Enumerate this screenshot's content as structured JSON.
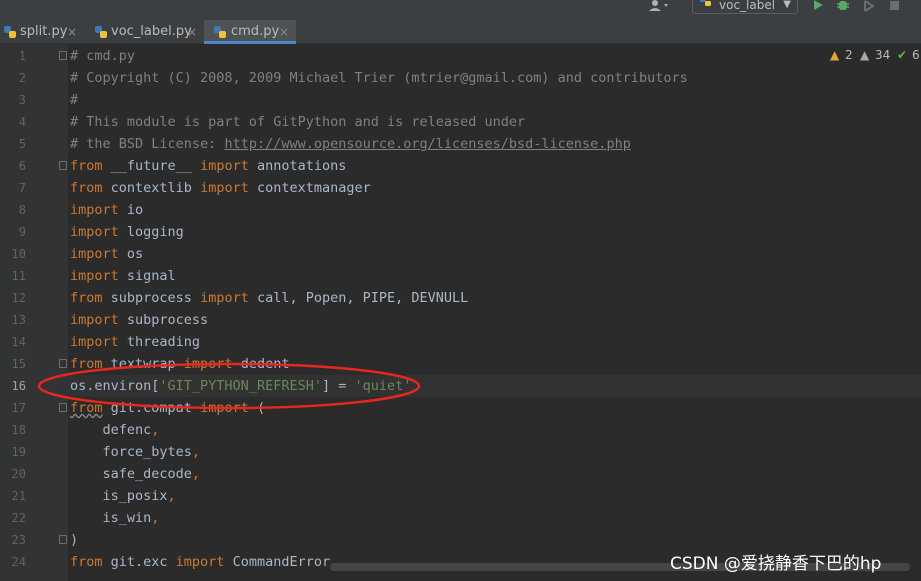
{
  "toolbar": {
    "run_config_label": "voc_label",
    "icons": [
      "user-icon",
      "python-file-icon",
      "chevron-down-icon",
      "run-icon",
      "debug-icon",
      "coverage-icon",
      "stop-icon"
    ]
  },
  "tabs": [
    {
      "label": "split.py",
      "close": "×",
      "active": false
    },
    {
      "label": "voc_label.py",
      "close": "×",
      "active": false
    },
    {
      "label": "cmd.py",
      "close": "×",
      "active": true
    }
  ],
  "inspections": {
    "warnings": "2",
    "weak_warnings": "34",
    "typos": "6",
    "warning_symbol": "▲",
    "weak_symbol": "▲",
    "check_symbol": "✔"
  },
  "current_line": 16,
  "lines": [
    {
      "n": "1",
      "tokens": [
        {
          "t": "cm",
          "v": "# cmd.py"
        }
      ]
    },
    {
      "n": "2",
      "tokens": [
        {
          "t": "cm",
          "v": "# Copyright (C) 2008, 2009 Michael Trier (mtrier@gmail.com) and contributors"
        }
      ]
    },
    {
      "n": "3",
      "tokens": [
        {
          "t": "cm",
          "v": "#"
        }
      ]
    },
    {
      "n": "4",
      "tokens": [
        {
          "t": "cm",
          "v": "# This module is part of GitPython and is released under"
        }
      ]
    },
    {
      "n": "5",
      "tokens": [
        {
          "t": "cm",
          "v": "# the BSD License: "
        },
        {
          "t": "link",
          "v": "http://www.opensource.org/licenses/bsd-license.php"
        }
      ]
    },
    {
      "n": "6",
      "tokens": [
        {
          "t": "kw",
          "v": "from"
        },
        {
          "t": "ident",
          "v": " __future__ "
        },
        {
          "t": "kw",
          "v": "import"
        },
        {
          "t": "ident",
          "v": " annotations"
        }
      ]
    },
    {
      "n": "7",
      "tokens": [
        {
          "t": "kw",
          "v": "from"
        },
        {
          "t": "ident",
          "v": " contextlib "
        },
        {
          "t": "kw",
          "v": "import"
        },
        {
          "t": "ident",
          "v": " contextmanager"
        }
      ]
    },
    {
      "n": "8",
      "tokens": [
        {
          "t": "kw",
          "v": "import"
        },
        {
          "t": "ident",
          "v": " io"
        }
      ]
    },
    {
      "n": "9",
      "tokens": [
        {
          "t": "kw",
          "v": "import"
        },
        {
          "t": "ident",
          "v": " logging"
        }
      ]
    },
    {
      "n": "10",
      "tokens": [
        {
          "t": "kw",
          "v": "import"
        },
        {
          "t": "ident",
          "v": " os"
        }
      ]
    },
    {
      "n": "11",
      "tokens": [
        {
          "t": "kw",
          "v": "import"
        },
        {
          "t": "ident",
          "v": " signal"
        }
      ]
    },
    {
      "n": "12",
      "tokens": [
        {
          "t": "kw",
          "v": "from"
        },
        {
          "t": "ident",
          "v": " subprocess "
        },
        {
          "t": "kw",
          "v": "import"
        },
        {
          "t": "ident",
          "v": " call, Popen, PIPE, DEVNULL"
        }
      ]
    },
    {
      "n": "13",
      "tokens": [
        {
          "t": "kw",
          "v": "import"
        },
        {
          "t": "ident",
          "v": " subprocess"
        }
      ]
    },
    {
      "n": "14",
      "tokens": [
        {
          "t": "kw",
          "v": "import"
        },
        {
          "t": "ident",
          "v": " threading"
        }
      ]
    },
    {
      "n": "15",
      "tokens": [
        {
          "t": "kw",
          "v": "from"
        },
        {
          "t": "ident",
          "v": " textwrap "
        },
        {
          "t": "kw",
          "v": "import"
        },
        {
          "t": "ident",
          "v": " dedent"
        }
      ]
    },
    {
      "n": "16",
      "tokens": [
        {
          "t": "ident",
          "v": "os.environ["
        },
        {
          "t": "st",
          "v": "'GIT_PYTHON_REFRESH'"
        },
        {
          "t": "ident",
          "v": "] = "
        },
        {
          "t": "st",
          "v": "'quiet'"
        }
      ]
    },
    {
      "n": "17",
      "tokens": [
        {
          "t": "kw-squig",
          "v": "from"
        },
        {
          "t": "ident",
          "v": " git.compat "
        },
        {
          "t": "kw",
          "v": "import"
        },
        {
          "t": "ident",
          "v": " ("
        }
      ]
    },
    {
      "n": "18",
      "tokens": [
        {
          "t": "ident",
          "v": "    defenc"
        },
        {
          "t": "kw",
          "v": ","
        }
      ]
    },
    {
      "n": "19",
      "tokens": [
        {
          "t": "ident",
          "v": "    force_bytes"
        },
        {
          "t": "kw",
          "v": ","
        }
      ]
    },
    {
      "n": "20",
      "tokens": [
        {
          "t": "ident",
          "v": "    safe_decode"
        },
        {
          "t": "kw",
          "v": ","
        }
      ]
    },
    {
      "n": "21",
      "tokens": [
        {
          "t": "ident",
          "v": "    is_posix"
        },
        {
          "t": "kw",
          "v": ","
        }
      ]
    },
    {
      "n": "22",
      "tokens": [
        {
          "t": "ident",
          "v": "    is_win"
        },
        {
          "t": "kw",
          "v": ","
        }
      ]
    },
    {
      "n": "23",
      "tokens": [
        {
          "t": "ident",
          "v": ")"
        }
      ]
    },
    {
      "n": "24",
      "tokens": [
        {
          "t": "kw",
          "v": "from"
        },
        {
          "t": "ident",
          "v": " git.exc "
        },
        {
          "t": "kw",
          "v": "import"
        },
        {
          "t": "ident",
          "v": " CommandError"
        }
      ]
    }
  ],
  "watermark": "CSDN @爱挠静香下巴的hp",
  "annotation_color": "#e8271e"
}
